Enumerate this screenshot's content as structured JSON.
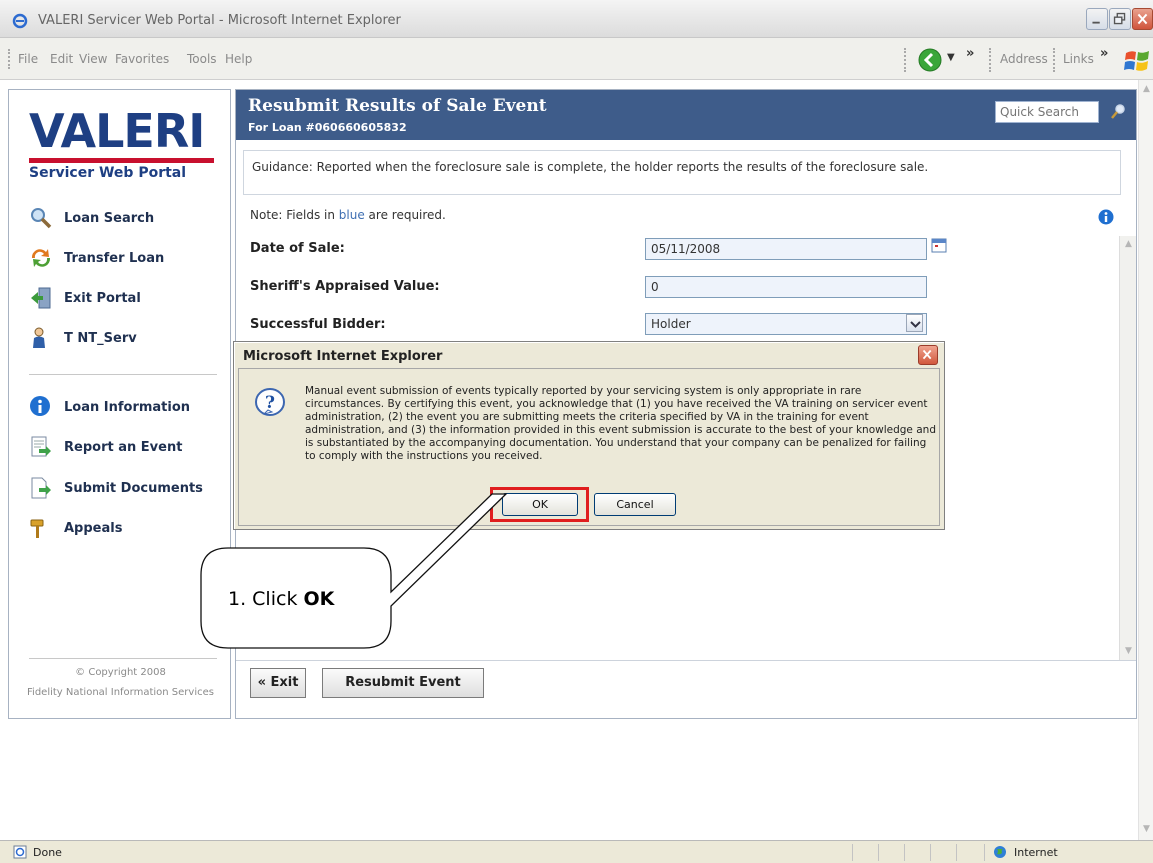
{
  "window": {
    "title": "VALERI Servicer Web Portal - Microsoft Internet Explorer"
  },
  "menubar": {
    "items": [
      "File",
      "Edit",
      "View",
      "Favorites",
      "Tools",
      "Help"
    ],
    "address_label": "Address",
    "links_label": "Links"
  },
  "sidebar": {
    "logo_text": "VALERI",
    "logo_subtitle": "Servicer Web Portal",
    "nav_top": [
      {
        "label": "Loan Search",
        "icon": "magnifier-icon"
      },
      {
        "label": "Transfer Loan",
        "icon": "transfer-arrows-icon"
      },
      {
        "label": "Exit Portal",
        "icon": "exit-door-icon"
      },
      {
        "label": "T NT_Serv",
        "icon": "user-icon"
      }
    ],
    "nav_bottom": [
      {
        "label": "Loan Information",
        "icon": "info-icon"
      },
      {
        "label": "Report an Event",
        "icon": "report-document-icon"
      },
      {
        "label": "Submit Documents",
        "icon": "submit-document-icon"
      },
      {
        "label": "Appeals",
        "icon": "gavel-icon"
      }
    ],
    "copyright_line1": "© Copyright 2008",
    "copyright_line2": "Fidelity National Information Services"
  },
  "main": {
    "title": "Resubmit Results of Sale Event",
    "subtitle": "For Loan #060660605832",
    "quick_search_placeholder": "Quick Search",
    "guidance": "Guidance: Reported when the foreclosure sale is complete, the holder reports the results of the foreclosure sale.",
    "note_prefix": "Note: Fields in ",
    "note_blue": "blue",
    "note_suffix": " are required.",
    "fields": {
      "date_of_sale_label": "Date of Sale:",
      "date_of_sale_value": "05/11/2008",
      "appraised_label": "Sheriff's Appraised Value:",
      "appraised_value": "0",
      "bidder_label": "Successful Bidder:",
      "bidder_value": "Holder"
    },
    "buttons": {
      "exit": "« Exit",
      "resubmit": "Resubmit Event"
    }
  },
  "dialog": {
    "title": "Microsoft Internet Explorer",
    "message": "Manual event submission of events typically reported by your servicing system is only appropriate in rare circumstances. By certifying this event, you acknowledge that (1) you have received the VA training on servicer event administration, (2) the event you are submitting meets the criteria specified by VA in the training for event administration, and (3) the information provided in this event submission is accurate to the best of your knowledge and is substantiated by the accompanying documentation. You understand that your company can be penalized for failing to comply with the instructions you received.",
    "ok_label": "OK",
    "cancel_label": "Cancel"
  },
  "callout": {
    "prefix": "1. Click ",
    "bold": "OK"
  },
  "statusbar": {
    "status": "Done",
    "zone": "Internet"
  },
  "colors": {
    "header_blue": "#3e5c8a",
    "brand_navy": "#1e3f83",
    "brand_red": "#c8102e",
    "highlight_red": "#e01e1e",
    "required_field_bg": "#eef3fb"
  }
}
